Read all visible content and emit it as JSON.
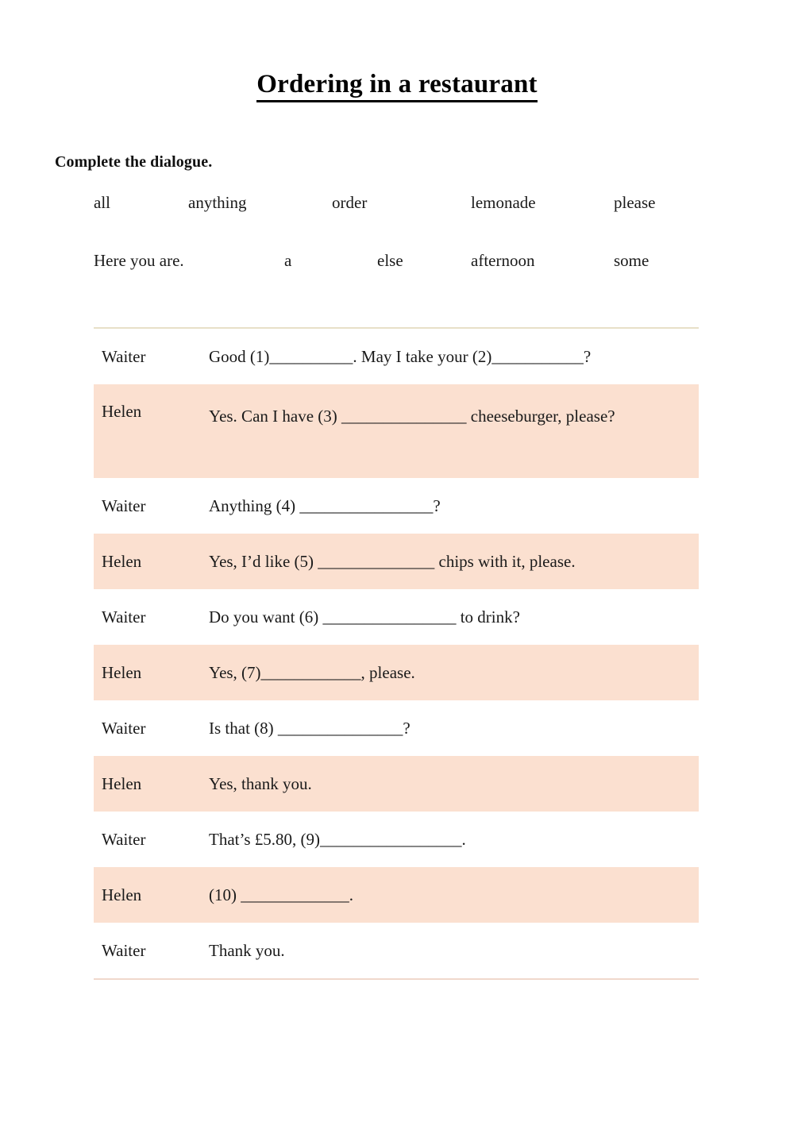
{
  "worksheet": {
    "title": "Ordering in a restaurant",
    "instruction": "Complete the dialogue.",
    "colors": {
      "highlight_row": "#fbe0d0",
      "page_background": "#ffffff",
      "text": "#1a1a1a",
      "table_top_border": "#e8e0c8",
      "table_bottom_border": "#f0d8cc"
    }
  },
  "word_bank": {
    "rows": [
      {
        "words": [
          "all",
          "anything",
          "order",
          "lemonade",
          "please"
        ]
      },
      {
        "words": [
          "Here you are.",
          "a",
          "else",
          "afternoon",
          "some"
        ]
      }
    ]
  },
  "dialogue": {
    "rows": [
      {
        "speaker": "Waiter",
        "line": "Good (1)__________. May I take your (2)___________?",
        "highlighted": false,
        "tall": false
      },
      {
        "speaker": "Helen",
        "line": "Yes. Can I have (3) _______________ cheeseburger, please?",
        "highlighted": true,
        "tall": true
      },
      {
        "speaker": "Waiter",
        "line": "Anything (4) ________________?",
        "highlighted": false,
        "tall": false
      },
      {
        "speaker": "Helen",
        "line": "Yes, I’d like (5) ______________ chips with it, please.",
        "highlighted": true,
        "tall": false
      },
      {
        "speaker": "Waiter",
        "line": "Do you want (6) ________________ to drink?",
        "highlighted": false,
        "tall": false
      },
      {
        "speaker": "Helen",
        "line": "Yes, (7)____________, please.",
        "highlighted": true,
        "tall": false
      },
      {
        "speaker": "Waiter",
        "line": "Is that (8) _______________?",
        "highlighted": false,
        "tall": false
      },
      {
        "speaker": "Helen",
        "line": "Yes, thank you.",
        "highlighted": true,
        "tall": false
      },
      {
        "speaker": "Waiter",
        "line": "That’s £5.80, (9)_________________.",
        "highlighted": false,
        "tall": false
      },
      {
        "speaker": "Helen",
        "line": "(10) _____________.",
        "highlighted": true,
        "tall": false
      },
      {
        "speaker": "Waiter",
        "line": "Thank you.",
        "highlighted": false,
        "tall": false
      }
    ]
  }
}
